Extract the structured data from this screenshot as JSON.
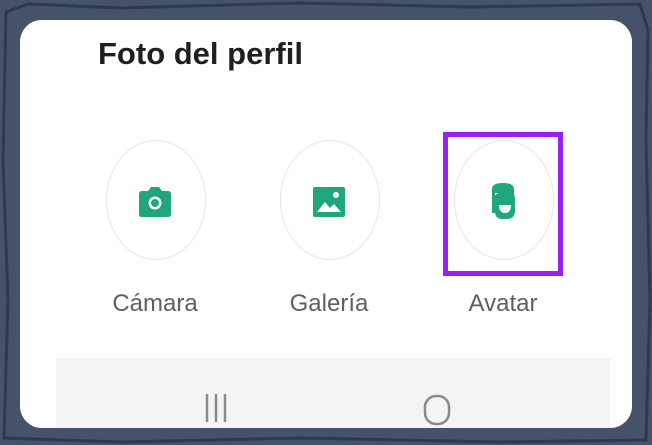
{
  "sheet": {
    "title": "Foto del perfil"
  },
  "options": [
    {
      "label": "Cámara",
      "icon": "camera-icon",
      "selected": false
    },
    {
      "label": "Galería",
      "icon": "gallery-icon",
      "selected": false
    },
    {
      "label": "Avatar",
      "icon": "avatar-icon",
      "selected": true
    }
  ],
  "nav": {
    "recents_icon": "recents-icon",
    "home_icon": "home-icon"
  },
  "colors": {
    "accent_green": "#1fa67c",
    "highlight_purple": "#9b1ff0",
    "frame": "#46516a"
  }
}
